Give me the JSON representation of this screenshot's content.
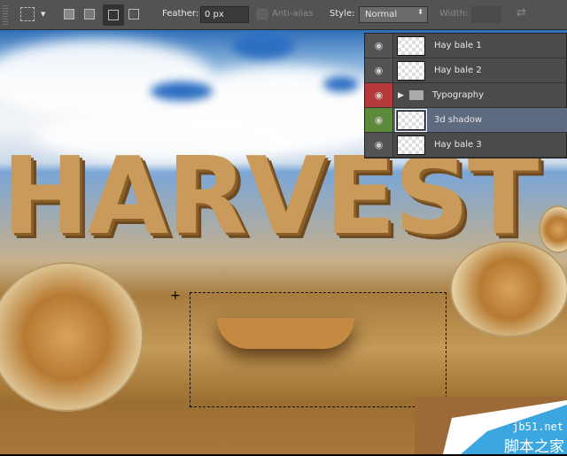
{
  "toolbar": {
    "feather_label": "Feather:",
    "feather_value": "0 px",
    "antialias_label": "Anti-alias",
    "style_label": "Style:",
    "style_value": "Normal",
    "width_label": "Width:"
  },
  "canvas": {
    "artwork_text": "HARVEST"
  },
  "layers": [
    {
      "name": "Hay bale 1",
      "eye_color": "#535353",
      "selected": false
    },
    {
      "name": "Hay bale 2",
      "eye_color": "#535353",
      "selected": false
    },
    {
      "name": "Typography",
      "eye_color": "#b5393b",
      "selected": false,
      "type": "group"
    },
    {
      "name": "3d shadow",
      "eye_color": "#5d8a3a",
      "selected": true
    },
    {
      "name": "Hay bale 3",
      "eye_color": "#535353",
      "selected": false
    }
  ],
  "watermark": {
    "url": "jb51.net",
    "name": "脚本之家"
  }
}
